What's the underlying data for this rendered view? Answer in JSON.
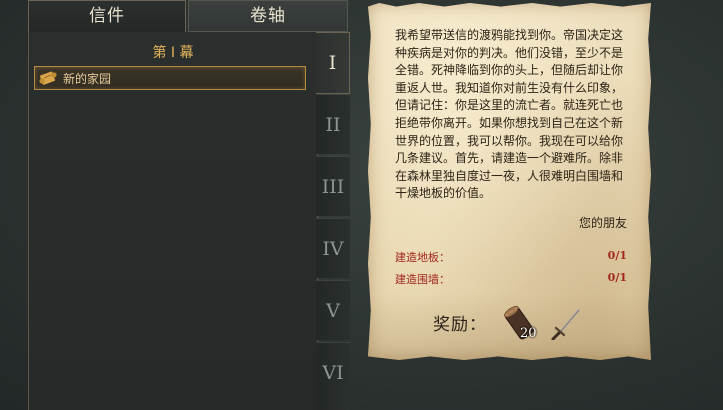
{
  "tabs": {
    "letters": "信件",
    "scrolls": "卷轴"
  },
  "chapter": {
    "title": "第 I 幕"
  },
  "entries": [
    {
      "label": "新的家园"
    }
  ],
  "chapter_numerals": [
    "I",
    "II",
    "III",
    "IV",
    "V",
    "VI"
  ],
  "letter": {
    "body": "我希望带送信的渡鸦能找到你。帝国决定这种疾病是对你的判决。他们没错，至少不是全错。死神降临到你的头上，但随后却让你重返人世。我知道你对前生没有什么印象，但请记住：你是这里的流亡者。就连死亡也拒绝带你离开。如果你想找到自己在这个新世界的位置，我可以帮你。我现在可以给你几条建议。首先，请建造一个避难所。除非在森林里独自度过一夜，人很难明白围墙和干燥地板的价值。",
    "signature": "您的朋友"
  },
  "objectives": [
    {
      "label": "建造地板：",
      "value": "0/1"
    },
    {
      "label": "建造围墙：",
      "value": "0/1"
    }
  ],
  "reward": {
    "label": "奖励：",
    "items": [
      {
        "icon": "log-icon",
        "count": "20"
      },
      {
        "icon": "sword-icon"
      }
    ]
  },
  "colors": {
    "accent": "#e3b25a",
    "objective_text": "#a2281e",
    "parchment": "#eee0bf"
  }
}
